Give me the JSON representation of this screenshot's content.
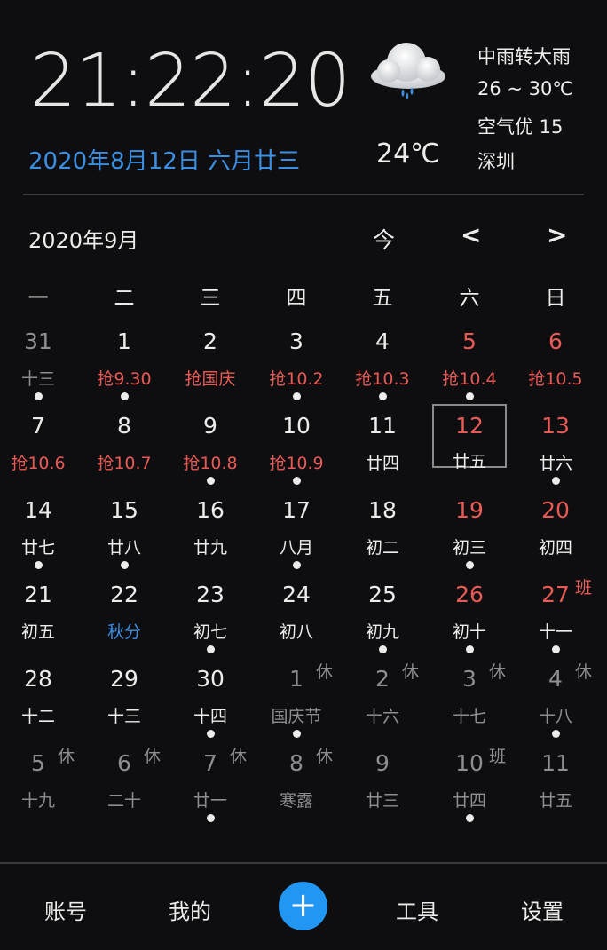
{
  "header": {
    "time": "21:22:20",
    "date": "2020年8月12日 六月廿三",
    "temperature": "24℃",
    "condition": "中雨转大雨",
    "range": "26 ~ 30℃",
    "air": "空气优 15",
    "city": "深圳"
  },
  "calendar": {
    "month_title": "2020年9月",
    "today_label": "今",
    "prev_label": "<",
    "next_label": ">",
    "weekdays": [
      "一",
      "二",
      "三",
      "四",
      "五",
      "六",
      "日"
    ],
    "rows": [
      [
        {
          "num": "31",
          "sub": "十三",
          "dot": true,
          "style": "dim",
          "sub_style": "dim"
        },
        {
          "num": "1",
          "sub": "抢9.30",
          "dot": true,
          "sub_style": "red"
        },
        {
          "num": "2",
          "sub": "抢国庆",
          "dot": false,
          "sub_style": "red"
        },
        {
          "num": "3",
          "sub": "抢10.2",
          "dot": true,
          "sub_style": "red"
        },
        {
          "num": "4",
          "sub": "抢10.3",
          "dot": true,
          "sub_style": "red"
        },
        {
          "num": "5",
          "sub": "抢10.4",
          "dot": true,
          "style": "red",
          "sub_style": "red"
        },
        {
          "num": "6",
          "sub": "抢10.5",
          "dot": false,
          "style": "red",
          "sub_style": "red"
        }
      ],
      [
        {
          "num": "7",
          "sub": "抢10.6",
          "dot": false,
          "sub_style": "red"
        },
        {
          "num": "8",
          "sub": "抢10.7",
          "dot": false,
          "sub_style": "red"
        },
        {
          "num": "9",
          "sub": "抢10.8",
          "dot": true,
          "sub_style": "red"
        },
        {
          "num": "10",
          "sub": "抢10.9",
          "dot": true,
          "sub_style": "red"
        },
        {
          "num": "11",
          "sub": "廿四",
          "dot": false
        },
        {
          "num": "12",
          "sub": "廿五",
          "dot": false,
          "style": "red",
          "selected": true
        },
        {
          "num": "13",
          "sub": "廿六",
          "dot": true,
          "style": "red"
        }
      ],
      [
        {
          "num": "14",
          "sub": "廿七",
          "dot": true
        },
        {
          "num": "15",
          "sub": "廿八",
          "dot": true
        },
        {
          "num": "16",
          "sub": "廿九",
          "dot": false
        },
        {
          "num": "17",
          "sub": "八月",
          "dot": true
        },
        {
          "num": "18",
          "sub": "初二",
          "dot": false
        },
        {
          "num": "19",
          "sub": "初三",
          "dot": true,
          "style": "red"
        },
        {
          "num": "20",
          "sub": "初四",
          "dot": false,
          "style": "red"
        }
      ],
      [
        {
          "num": "21",
          "sub": "初五",
          "dot": false
        },
        {
          "num": "22",
          "sub": "秋分",
          "dot": false,
          "sub_style": "blue"
        },
        {
          "num": "23",
          "sub": "初七",
          "dot": true
        },
        {
          "num": "24",
          "sub": "初八",
          "dot": false
        },
        {
          "num": "25",
          "sub": "初九",
          "dot": true
        },
        {
          "num": "26",
          "sub": "初十",
          "dot": true,
          "style": "red"
        },
        {
          "num": "27",
          "sub": "十一",
          "dot": true,
          "style": "red",
          "tag": "班",
          "tag_style": "red"
        }
      ],
      [
        {
          "num": "28",
          "sub": "十二",
          "dot": false
        },
        {
          "num": "29",
          "sub": "十三",
          "dot": false
        },
        {
          "num": "30",
          "sub": "十四",
          "dot": true
        },
        {
          "num": "1",
          "sub": "国庆节",
          "dot": true,
          "style": "dim",
          "sub_style": "dim",
          "tag": "休",
          "tag_style": "dim"
        },
        {
          "num": "2",
          "sub": "十六",
          "dot": false,
          "style": "dim",
          "sub_style": "dim",
          "tag": "休",
          "tag_style": "dim"
        },
        {
          "num": "3",
          "sub": "十七",
          "dot": false,
          "style": "dim",
          "sub_style": "dim",
          "tag": "休",
          "tag_style": "dim"
        },
        {
          "num": "4",
          "sub": "十八",
          "dot": true,
          "style": "dim",
          "sub_style": "dim",
          "tag": "休",
          "tag_style": "dim"
        }
      ],
      [
        {
          "num": "5",
          "sub": "十九",
          "dot": false,
          "style": "dim",
          "sub_style": "dim",
          "tag": "休",
          "tag_style": "dim"
        },
        {
          "num": "6",
          "sub": "二十",
          "dot": false,
          "style": "dim",
          "sub_style": "dim",
          "tag": "休",
          "tag_style": "dim"
        },
        {
          "num": "7",
          "sub": "廿一",
          "dot": true,
          "style": "dim",
          "sub_style": "dim",
          "tag": "休",
          "tag_style": "dim"
        },
        {
          "num": "8",
          "sub": "寒露",
          "dot": false,
          "style": "dim",
          "sub_style": "dim",
          "tag": "休",
          "tag_style": "dim"
        },
        {
          "num": "9",
          "sub": "廿三",
          "dot": false,
          "style": "dim",
          "sub_style": "dim"
        },
        {
          "num": "10",
          "sub": "廿四",
          "dot": true,
          "style": "dim",
          "sub_style": "dim",
          "tag": "班",
          "tag_style": "dim"
        },
        {
          "num": "11",
          "sub": "廿五",
          "dot": false,
          "style": "dim",
          "sub_style": "dim"
        }
      ]
    ]
  },
  "bottom_nav": {
    "account": "账号",
    "mine": "我的",
    "add": "+",
    "tools": "工具",
    "settings": "设置"
  },
  "colors": {
    "accent": "#2196f3",
    "date_blue": "#3b8fe3",
    "holiday_red": "#e85a56",
    "dim_gray": "#8e8e90",
    "background": "#0e0e10"
  },
  "icons": {
    "weather": "rain-cloud-icon"
  }
}
